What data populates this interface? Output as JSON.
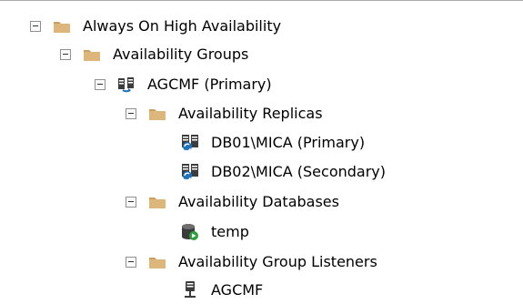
{
  "tree": {
    "root": {
      "label": "Always On High Availability",
      "icon": "folder-icon",
      "expanded": true
    },
    "availability_groups": {
      "label": "Availability Groups",
      "icon": "folder-icon",
      "expanded": true
    },
    "ag": {
      "label": "AGCMF (Primary)",
      "icon": "availability-group-icon",
      "expanded": true
    },
    "replicas_folder": {
      "label": "Availability Replicas",
      "icon": "folder-icon",
      "expanded": true
    },
    "replicas": [
      {
        "label": "DB01\\MICA (Primary)",
        "icon": "replica-icon"
      },
      {
        "label": "DB02\\MICA (Secondary)",
        "icon": "replica-icon"
      }
    ],
    "databases_folder": {
      "label": "Availability Databases",
      "icon": "folder-icon",
      "expanded": true
    },
    "databases": [
      {
        "label": "temp",
        "icon": "database-icon"
      }
    ],
    "listeners_folder": {
      "label": "Availability Group Listeners",
      "icon": "folder-icon",
      "expanded": true
    },
    "listeners": [
      {
        "label": "AGCMF",
        "icon": "listener-icon"
      }
    ]
  },
  "colors": {
    "folder": "#dcb67a",
    "folder_dark": "#c9a05e",
    "replica_blue": "#1e73be",
    "database_green": "#2e9e3e",
    "toggle_border": "#919191"
  }
}
